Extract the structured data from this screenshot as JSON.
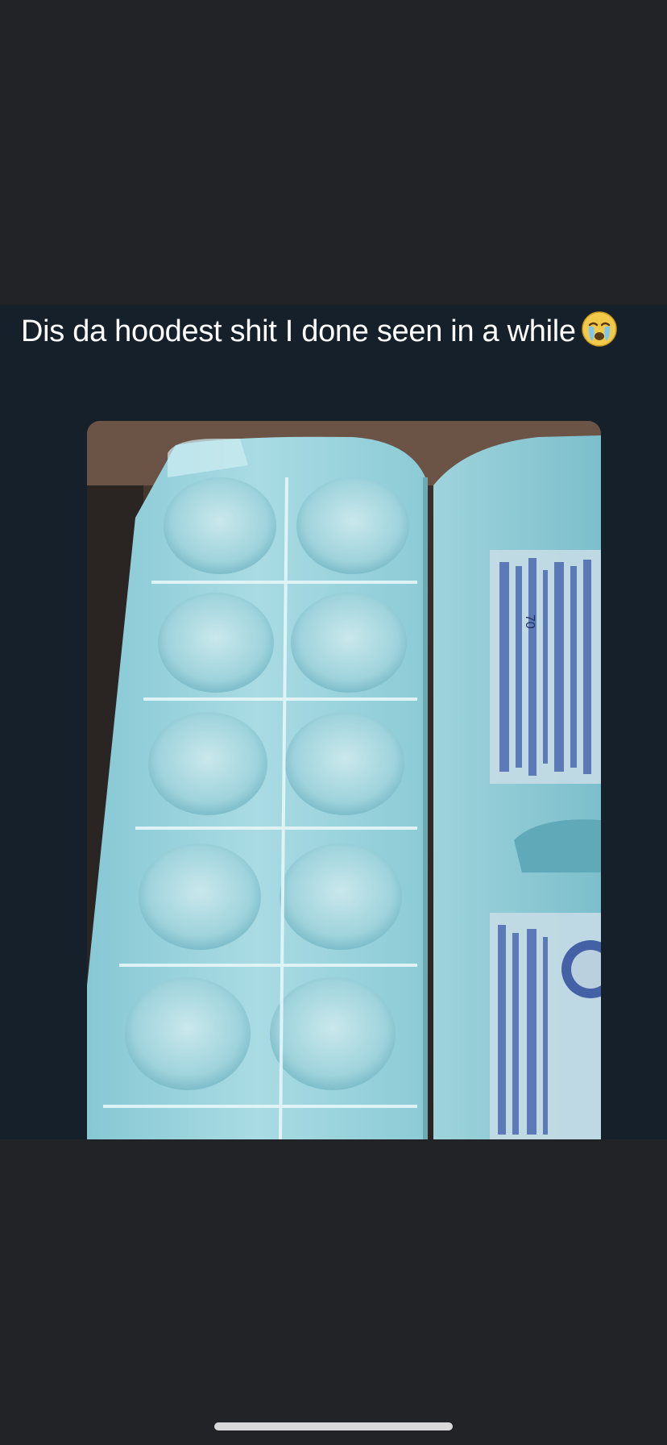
{
  "tweet": {
    "text": "Dis da hoodest shit I done seen in a while",
    "emoji": "crying-face-emoji"
  },
  "media": {
    "description_icon": "egg-carton-ice-tray-photo",
    "carton_number": "70"
  },
  "colors": {
    "background": "#222327",
    "tweet_panel": "#15202b",
    "text": "#ffffff",
    "carton_blue": "#8fcdd8",
    "home_indicator": "#d8d8d8"
  }
}
